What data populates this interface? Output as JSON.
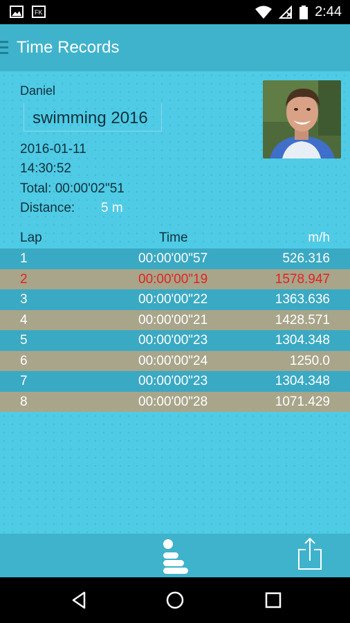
{
  "status_bar": {
    "time": "2:44",
    "icons": [
      "image-icon",
      "fk-app-icon",
      "wifi-icon",
      "no-signal-icon",
      "battery-icon"
    ]
  },
  "app_bar": {
    "title": "Time Records",
    "menu_icon": "menu-handle-icon"
  },
  "record": {
    "athlete": "Daniel",
    "event": "swimming 2016",
    "date": "2016-01-11",
    "time": "14:30:52",
    "total": "Total: 00:00'02\"51",
    "distance_label": "Distance:",
    "distance_value": "5 m"
  },
  "table": {
    "headers": {
      "lap": "Lap",
      "time": "Time",
      "speed": "m/h"
    },
    "rows": [
      {
        "lap": "1",
        "time": "00:00'00\"57",
        "speed": "526.316",
        "highlight": false
      },
      {
        "lap": "2",
        "time": "00:00'00\"19",
        "speed": "1578.947",
        "highlight": true
      },
      {
        "lap": "3",
        "time": "00:00'00\"22",
        "speed": "1363.636",
        "highlight": false
      },
      {
        "lap": "4",
        "time": "00:00'00\"21",
        "speed": "1428.571",
        "highlight": false
      },
      {
        "lap": "5",
        "time": "00:00'00\"23",
        "speed": "1304.348",
        "highlight": false
      },
      {
        "lap": "6",
        "time": "00:00'00\"24",
        "speed": "1250.0",
        "highlight": false
      },
      {
        "lap": "7",
        "time": "00:00'00\"23",
        "speed": "1304.348",
        "highlight": false
      },
      {
        "lap": "8",
        "time": "00:00'00\"28",
        "speed": "1071.429",
        "highlight": false
      }
    ]
  },
  "toolbar": {
    "left_icon": "podium-icon",
    "right_icon": "share-icon"
  },
  "nav_bar": {
    "icons": [
      "back-icon",
      "home-icon",
      "recents-icon"
    ]
  },
  "colors": {
    "accent": "#3fb3cc",
    "background": "#4fcbe6",
    "row_blue": "#3aa9c3",
    "row_olive": "#a8a58a",
    "highlight_red": "#e0231e"
  }
}
